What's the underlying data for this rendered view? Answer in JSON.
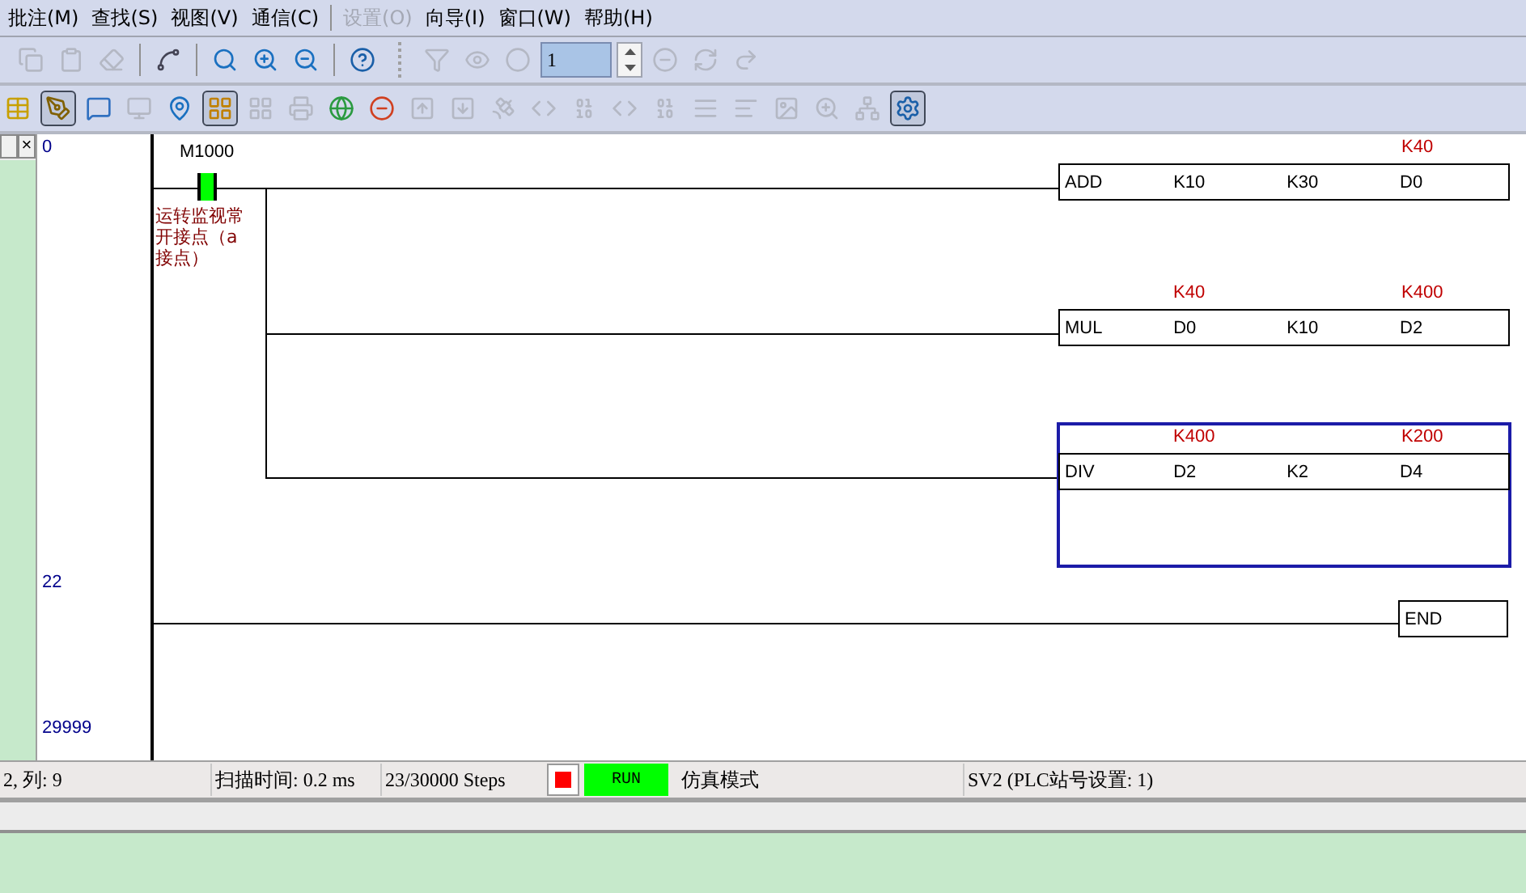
{
  "menu": [
    {
      "label": "批注(M)",
      "disabled": false
    },
    {
      "label": "查找(S)",
      "disabled": false
    },
    {
      "label": "视图(V)",
      "disabled": false
    },
    {
      "label": "通信(C)",
      "disabled": false
    },
    {
      "label": "设置(O)",
      "disabled": true
    },
    {
      "label": "向导(I)",
      "disabled": false
    },
    {
      "label": "窗口(W)",
      "disabled": false
    },
    {
      "label": "帮助(H)",
      "disabled": false
    }
  ],
  "toolbar": {
    "left": [
      {
        "disabled": true
      },
      {
        "disabled": true
      },
      {
        "disabled": true
      },
      {
        "disabled": false
      },
      {
        "disabled": false
      },
      {
        "disabled": false
      },
      {
        "disabled": false
      },
      {
        "disabled": false
      }
    ],
    "middle": [
      {
        "disabled": true
      },
      {
        "disabled": true
      },
      {
        "disabled": true
      }
    ],
    "counter": {
      "value": "1"
    },
    "right": [
      {
        "disabled": true
      },
      {
        "disabled": true
      },
      {
        "disabled": true
      }
    ]
  },
  "toolbar2": [
    {
      "pressed": false,
      "disabled": false
    },
    {
      "pressed": true,
      "disabled": false
    },
    {
      "pressed": false,
      "disabled": false
    },
    {
      "pressed": false,
      "disabled": true
    },
    {
      "pressed": false,
      "disabled": false
    },
    {
      "pressed": true,
      "disabled": false
    },
    {
      "pressed": false,
      "disabled": true
    },
    {
      "pressed": false,
      "disabled": true
    },
    {
      "pressed": false,
      "disabled": false
    },
    {
      "pressed": false,
      "disabled": false
    },
    {
      "pressed": false,
      "disabled": true
    },
    {
      "pressed": false,
      "disabled": true
    },
    {
      "pressed": false,
      "disabled": true
    },
    {
      "pressed": false,
      "disabled": true
    },
    {
      "pressed": false,
      "disabled": true
    },
    {
      "pressed": false,
      "disabled": true
    },
    {
      "pressed": false,
      "disabled": true
    },
    {
      "pressed": false,
      "disabled": true
    },
    {
      "pressed": false,
      "disabled": true
    },
    {
      "pressed": false,
      "disabled": true
    },
    {
      "pressed": false,
      "disabled": true
    },
    {
      "pressed": false,
      "disabled": true
    },
    {
      "pressed": true,
      "disabled": false
    }
  ],
  "side_panel": {
    "close": "×"
  },
  "ladder": {
    "rungs": [
      {
        "step": "0",
        "contact": {
          "address": "M1000",
          "on": true,
          "comment": "运转监视常开接点（a接点）"
        },
        "outputs": [
          {
            "instruction": "ADD",
            "selected": false,
            "operands": [
              {
                "text": "K10"
              },
              {
                "text": "K30"
              },
              {
                "text": "D0",
                "value": "K40"
              }
            ]
          },
          {
            "instruction": "MUL",
            "selected": false,
            "operands": [
              {
                "text": "D0",
                "value": "K40"
              },
              {
                "text": "K10"
              },
              {
                "text": "D2",
                "value": "K400"
              }
            ]
          },
          {
            "instruction": "DIV",
            "selected": true,
            "operands": [
              {
                "text": "D2",
                "value": "K400"
              },
              {
                "text": "K2"
              },
              {
                "text": "D4",
                "value": "K200"
              }
            ]
          }
        ]
      }
    ],
    "end": {
      "step": "22",
      "instruction": "END"
    },
    "last_step": "29999"
  },
  "status_bar": {
    "position": "2, 列: 9",
    "scan_time": "扫描时间: 0.2 ms",
    "steps": "23/30000 Steps",
    "stopped": true,
    "run": "RUN",
    "running": true,
    "mode": "仿真模式",
    "station": "SV2 (PLC站号设置: 1)"
  }
}
